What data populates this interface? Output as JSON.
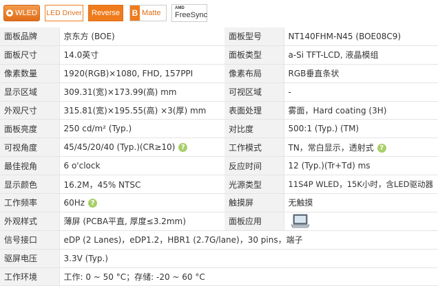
{
  "badges": {
    "wled": "WLED",
    "led_driver": "LED Driver",
    "reverse": "Reverse",
    "matte_letter": "B",
    "matte": "Matte",
    "amd": "AMD",
    "freesync": "FreeSync"
  },
  "spec": [
    {
      "l1": "面板品牌",
      "v1": "京东方 (BOE)",
      "l2": "面板型号",
      "v2": "NT140FHM-N45 (BOE08C9)"
    },
    {
      "l1": "面板尺寸",
      "v1": "14.0英寸",
      "l2": "面板类型",
      "v2": "a-Si TFT-LCD, 液晶模组"
    },
    {
      "l1": "像素数量",
      "v1": "1920(RGB)×1080, FHD, 157PPI",
      "l2": "像素布局",
      "v2": "RGB垂直条状"
    },
    {
      "l1": "显示区域",
      "v1": "309.31(宽)×173.99(高) mm",
      "l2": "可视区域",
      "v2": "-"
    },
    {
      "l1": "外观尺寸",
      "v1": "315.81(宽)×195.55(高) ×3(厚) mm",
      "l2": "表面处理",
      "v2": "雾面，Hard coating (3H)"
    },
    {
      "l1": "面板亮度",
      "v1": "250 cd/m² (Typ.)",
      "l2": "对比度",
      "v2": "500:1 (Typ.) (TM)"
    },
    {
      "l1": "可视角度",
      "v1": "45/45/20/40 (Typ.)(CR≥10)",
      "l2": "工作模式",
      "v2": "TN，常白显示，透射式"
    },
    {
      "l1": "最佳视角",
      "v1": "6 o'clock",
      "l2": "反应时间",
      "v2": "12 (Typ.)(Tr+Td) ms"
    },
    {
      "l1": "显示颜色",
      "v1": "16.2M，45% NTSC",
      "l2": "光源类型",
      "v2": "11S4P WLED，15K小时，含LED驱动器"
    },
    {
      "l1": "工作频率",
      "v1": "60Hz",
      "l2": "触摸屏",
      "v2": "无触摸"
    },
    {
      "l1": "外观样式",
      "v1": "薄屏 (PCBA平直, 厚度≤3.2mm)",
      "l2": "面板应用",
      "v2": ""
    },
    {
      "l1": "信号接口",
      "v1": "eDP (2 Lanes)，eDP1.2，HBR1 (2.7G/lane)，30 pins，端子"
    },
    {
      "l1": "驱屏电压",
      "v1": "3.3V (Typ.)"
    },
    {
      "l1": "工作环境",
      "v1": "工作: 0 ~ 50 °C；存储: -20 ~ 60 °C"
    }
  ],
  "help_glyph": "?",
  "icons": {
    "help": "help-circle-icon",
    "laptop": "laptop-icon"
  },
  "colors": {
    "accent_orange": "#ef7b1c",
    "help_green": "#a8cf6a",
    "label_bg": "#f2f2f2"
  }
}
